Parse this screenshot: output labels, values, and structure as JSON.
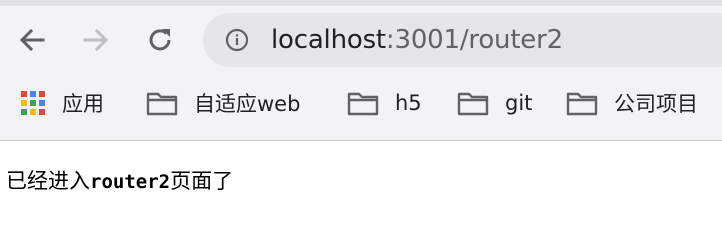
{
  "browser": {
    "url_host": "localhost",
    "url_rest": ":3001/router2",
    "icons": {
      "back": "arrow-left-icon",
      "forward": "arrow-right-icon",
      "reload": "reload-icon",
      "site_info": "info-icon",
      "apps": "apps-grid-icon",
      "folder": "folder-icon"
    }
  },
  "bookmarks": {
    "apps_label": "应用",
    "items": [
      {
        "label": "自适应web"
      },
      {
        "label": "h5"
      },
      {
        "label": "git"
      },
      {
        "label": "公司项目"
      }
    ]
  },
  "page": {
    "text_prefix": "已经进入",
    "text_route": "router2",
    "text_suffix": "页面了"
  },
  "colors": {
    "chrome_bg": "#f1f3f4",
    "omnibox_bg": "#e4e6e9",
    "icon_dark": "#5f6368",
    "icon_disabled": "#bdc1c6"
  }
}
